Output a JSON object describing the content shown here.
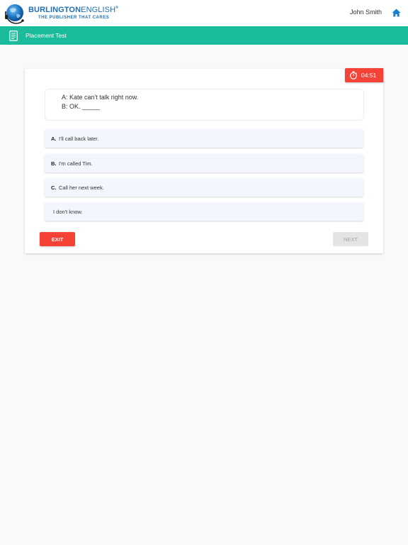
{
  "header": {
    "logo": {
      "brand_bold": "BURLINGTON",
      "brand_light": "ENGLISH",
      "trademark": "®",
      "tagline": "THE PUBLISHER THAT CARES"
    },
    "user_name": "John Smith",
    "home_icon": "home-icon",
    "accent_color": "#1d6fb8"
  },
  "title_bar": {
    "icon": "document-icon",
    "title": "Placement Test",
    "color": "#1abc9c"
  },
  "timer": {
    "icon": "stopwatch-icon",
    "value": "04:51",
    "color": "#f44336"
  },
  "question": {
    "line1": "A: Kate can't talk right now.",
    "line2_prefix": "B: OK. ",
    "line2_blank": "_____"
  },
  "options": [
    {
      "letter": "A.",
      "text": "I'll call back later."
    },
    {
      "letter": "B.",
      "text": "I'm called Tim."
    },
    {
      "letter": "C.",
      "text": "Call her next week."
    },
    {
      "letter": "",
      "text": "I don't know."
    }
  ],
  "buttons": {
    "exit_label": "EXIT",
    "next_label": "NEXT",
    "next_disabled": true
  }
}
